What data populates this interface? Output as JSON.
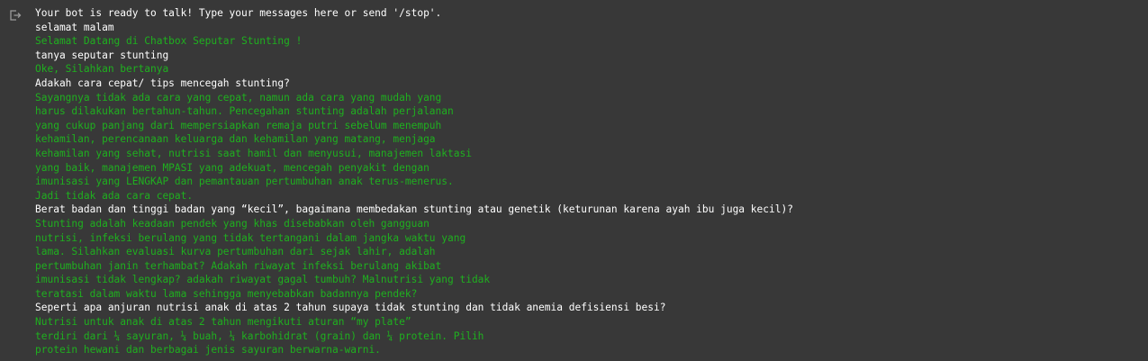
{
  "colors": {
    "background": "#383838",
    "user_text": "#ffffff",
    "bot_text": "#1fb01f"
  },
  "output_icon": "output-icon",
  "lines": [
    {
      "role": "sys",
      "text": "Your bot is ready to talk! Type your messages here or send '/stop'."
    },
    {
      "role": "user",
      "text": "selamat malam"
    },
    {
      "role": "bot",
      "text": "Selamat Datang di Chatbox Seputar Stunting !"
    },
    {
      "role": "user",
      "text": "tanya seputar stunting"
    },
    {
      "role": "bot",
      "text": "Oke, Silahkan bertanya"
    },
    {
      "role": "user",
      "text": "Adakah cara cepat/ tips mencegah stunting?"
    },
    {
      "role": "bot",
      "text": "Sayangnya tidak ada cara yang cepat, namun ada cara yang mudah yang"
    },
    {
      "role": "bot",
      "text": "harus dilakukan bertahun-tahun. Pencegahan stunting adalah perjalanan"
    },
    {
      "role": "bot",
      "text": "yang cukup panjang dari mempersiapkan remaja putri sebelum menempuh"
    },
    {
      "role": "bot",
      "text": "kehamilan, perencanaan keluarga dan kehamilan yang matang, menjaga"
    },
    {
      "role": "bot",
      "text": "kehamilan yang sehat, nutrisi saat hamil dan menyusui, manajemen laktasi"
    },
    {
      "role": "bot",
      "text": "yang baik, manajemen MPASI yang adekuat, mencegah penyakit dengan"
    },
    {
      "role": "bot",
      "text": "imunisasi yang LENGKAP dan pemantauan pertumbuhan anak terus-menerus."
    },
    {
      "role": "bot",
      "text": "Jadi tidak ada cara cepat."
    },
    {
      "role": "user",
      "text": "Berat badan dan tinggi badan yang “kecil”, bagaimana membedakan stunting atau genetik (keturunan karena ayah ibu juga kecil)?"
    },
    {
      "role": "bot",
      "text": "Stunting adalah keadaan pendek yang khas disebabkan oleh gangguan"
    },
    {
      "role": "bot",
      "text": "nutrisi, infeksi berulang yang tidak tertangani dalam jangka waktu yang"
    },
    {
      "role": "bot",
      "text": "lama. Silahkan evaluasi kurva pertumbuhan dari sejak lahir, adalah"
    },
    {
      "role": "bot",
      "text": "pertumbuhan janin terhambat? Adakah riwayat infeksi berulang akibat"
    },
    {
      "role": "bot",
      "text": "imunisasi tidak lengkap? adakah riwayat gagal tumbuh? Malnutrisi yang tidak"
    },
    {
      "role": "bot",
      "text": "teratasi dalam waktu lama sehingga menyebabkan badannya pendek?"
    },
    {
      "role": "user",
      "text": "Seperti apa anjuran nutrisi anak di atas 2 tahun supaya tidak stunting dan tidak anemia defisiensi besi?"
    },
    {
      "role": "bot",
      "text": "Nutrisi untuk anak di atas 2 tahun mengikuti aturan “my plate”"
    },
    {
      "role": "bot",
      "text": "terdiri dari ¼ sayuran, ¼ buah, ¼ karbohidrat (grain) dan ¼ protein. Pilih"
    },
    {
      "role": "bot",
      "text": "protein hewani dan berbagai jenis sayuran berwarna-warni."
    }
  ]
}
